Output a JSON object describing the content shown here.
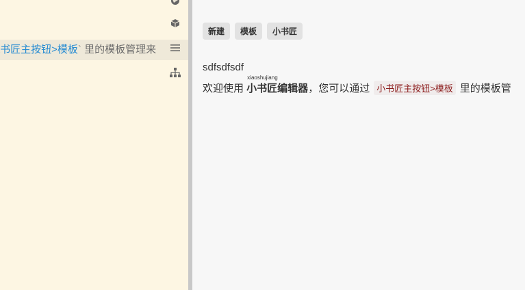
{
  "editor": {
    "code_line": {
      "prefix": "\\",
      "link_text": "书匠主按钮>模板",
      "tick": "`",
      "rest": " 里的模板管理来"
    },
    "icons": [
      "globe-icon",
      "cube-icon",
      "list-icon",
      "sitemap-icon"
    ]
  },
  "preview": {
    "tags": [
      "新建",
      "模板",
      "小书匠"
    ],
    "paragraph1": "sdfsdfsdf",
    "paragraph2": {
      "before": "欢迎使用 ",
      "ruby_text": "小书匠编辑器",
      "ruby_annotation": "xiaoshujiang",
      "middle": "，您可以通过",
      "code": "小书匠主按钮>模板",
      "after": "里的模板管"
    }
  }
}
